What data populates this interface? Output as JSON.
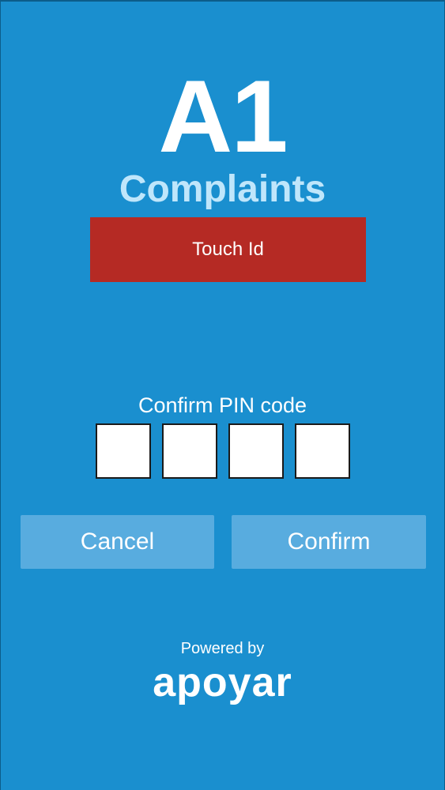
{
  "app": {
    "logo_title": "A1",
    "logo_subtitle": "Complaints"
  },
  "touch_id": {
    "label": "Touch Id",
    "color": "#b52a24"
  },
  "pin": {
    "label": "Confirm PIN code",
    "digits": [
      "",
      "",
      "",
      ""
    ]
  },
  "actions": {
    "cancel_label": "Cancel",
    "confirm_label": "Confirm"
  },
  "footer": {
    "powered_by": "Powered by",
    "brand": "apoyar"
  },
  "colors": {
    "background": "#1a8fcf",
    "button": "#58acdf",
    "subtitle": "#bfe6fb"
  }
}
